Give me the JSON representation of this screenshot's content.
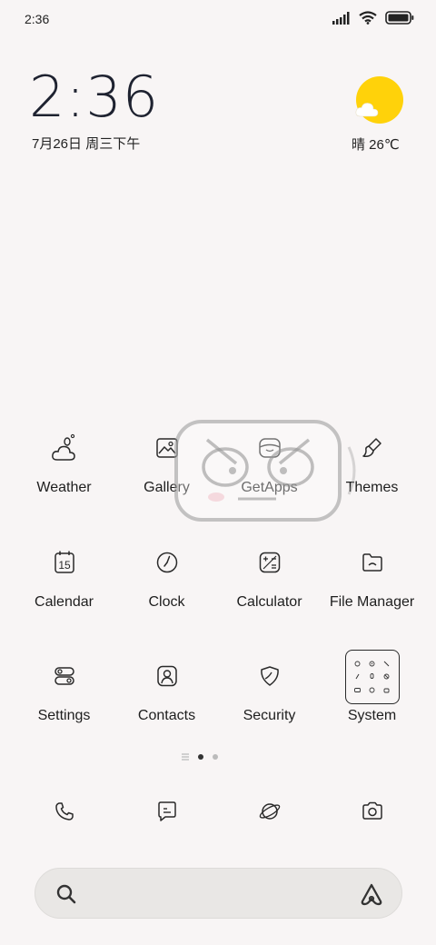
{
  "status_bar": {
    "time": "2:36"
  },
  "clock_widget": {
    "time": "2:36",
    "date": "7月26日 周三下午"
  },
  "weather_widget": {
    "text": "晴 26℃"
  },
  "apps": [
    {
      "label": "Weather",
      "icon": "weather-icon"
    },
    {
      "label": "Gallery",
      "icon": "gallery-icon"
    },
    {
      "label": "GetApps",
      "icon": "getapps-icon"
    },
    {
      "label": "Themes",
      "icon": "themes-icon"
    },
    {
      "label": "Calendar",
      "icon": "calendar-icon",
      "day": "15"
    },
    {
      "label": "Clock",
      "icon": "clock-icon"
    },
    {
      "label": "Calculator",
      "icon": "calculator-icon"
    },
    {
      "label": "File Manager",
      "icon": "file-manager-icon"
    },
    {
      "label": "Settings",
      "icon": "settings-icon"
    },
    {
      "label": "Contacts",
      "icon": "contacts-icon"
    },
    {
      "label": "Security",
      "icon": "security-icon"
    },
    {
      "label": "System",
      "icon": "system-folder-icon"
    }
  ],
  "page_indicator": {
    "pages": 2,
    "active": 1
  },
  "dock": [
    "phone-icon",
    "messages-icon",
    "browser-icon",
    "camera-icon"
  ],
  "search_bar": {
    "placeholder": ""
  },
  "colors": {
    "background": "#f8f5f5",
    "sun": "#ffd20a",
    "icon_stroke": "#2a2a2a"
  }
}
